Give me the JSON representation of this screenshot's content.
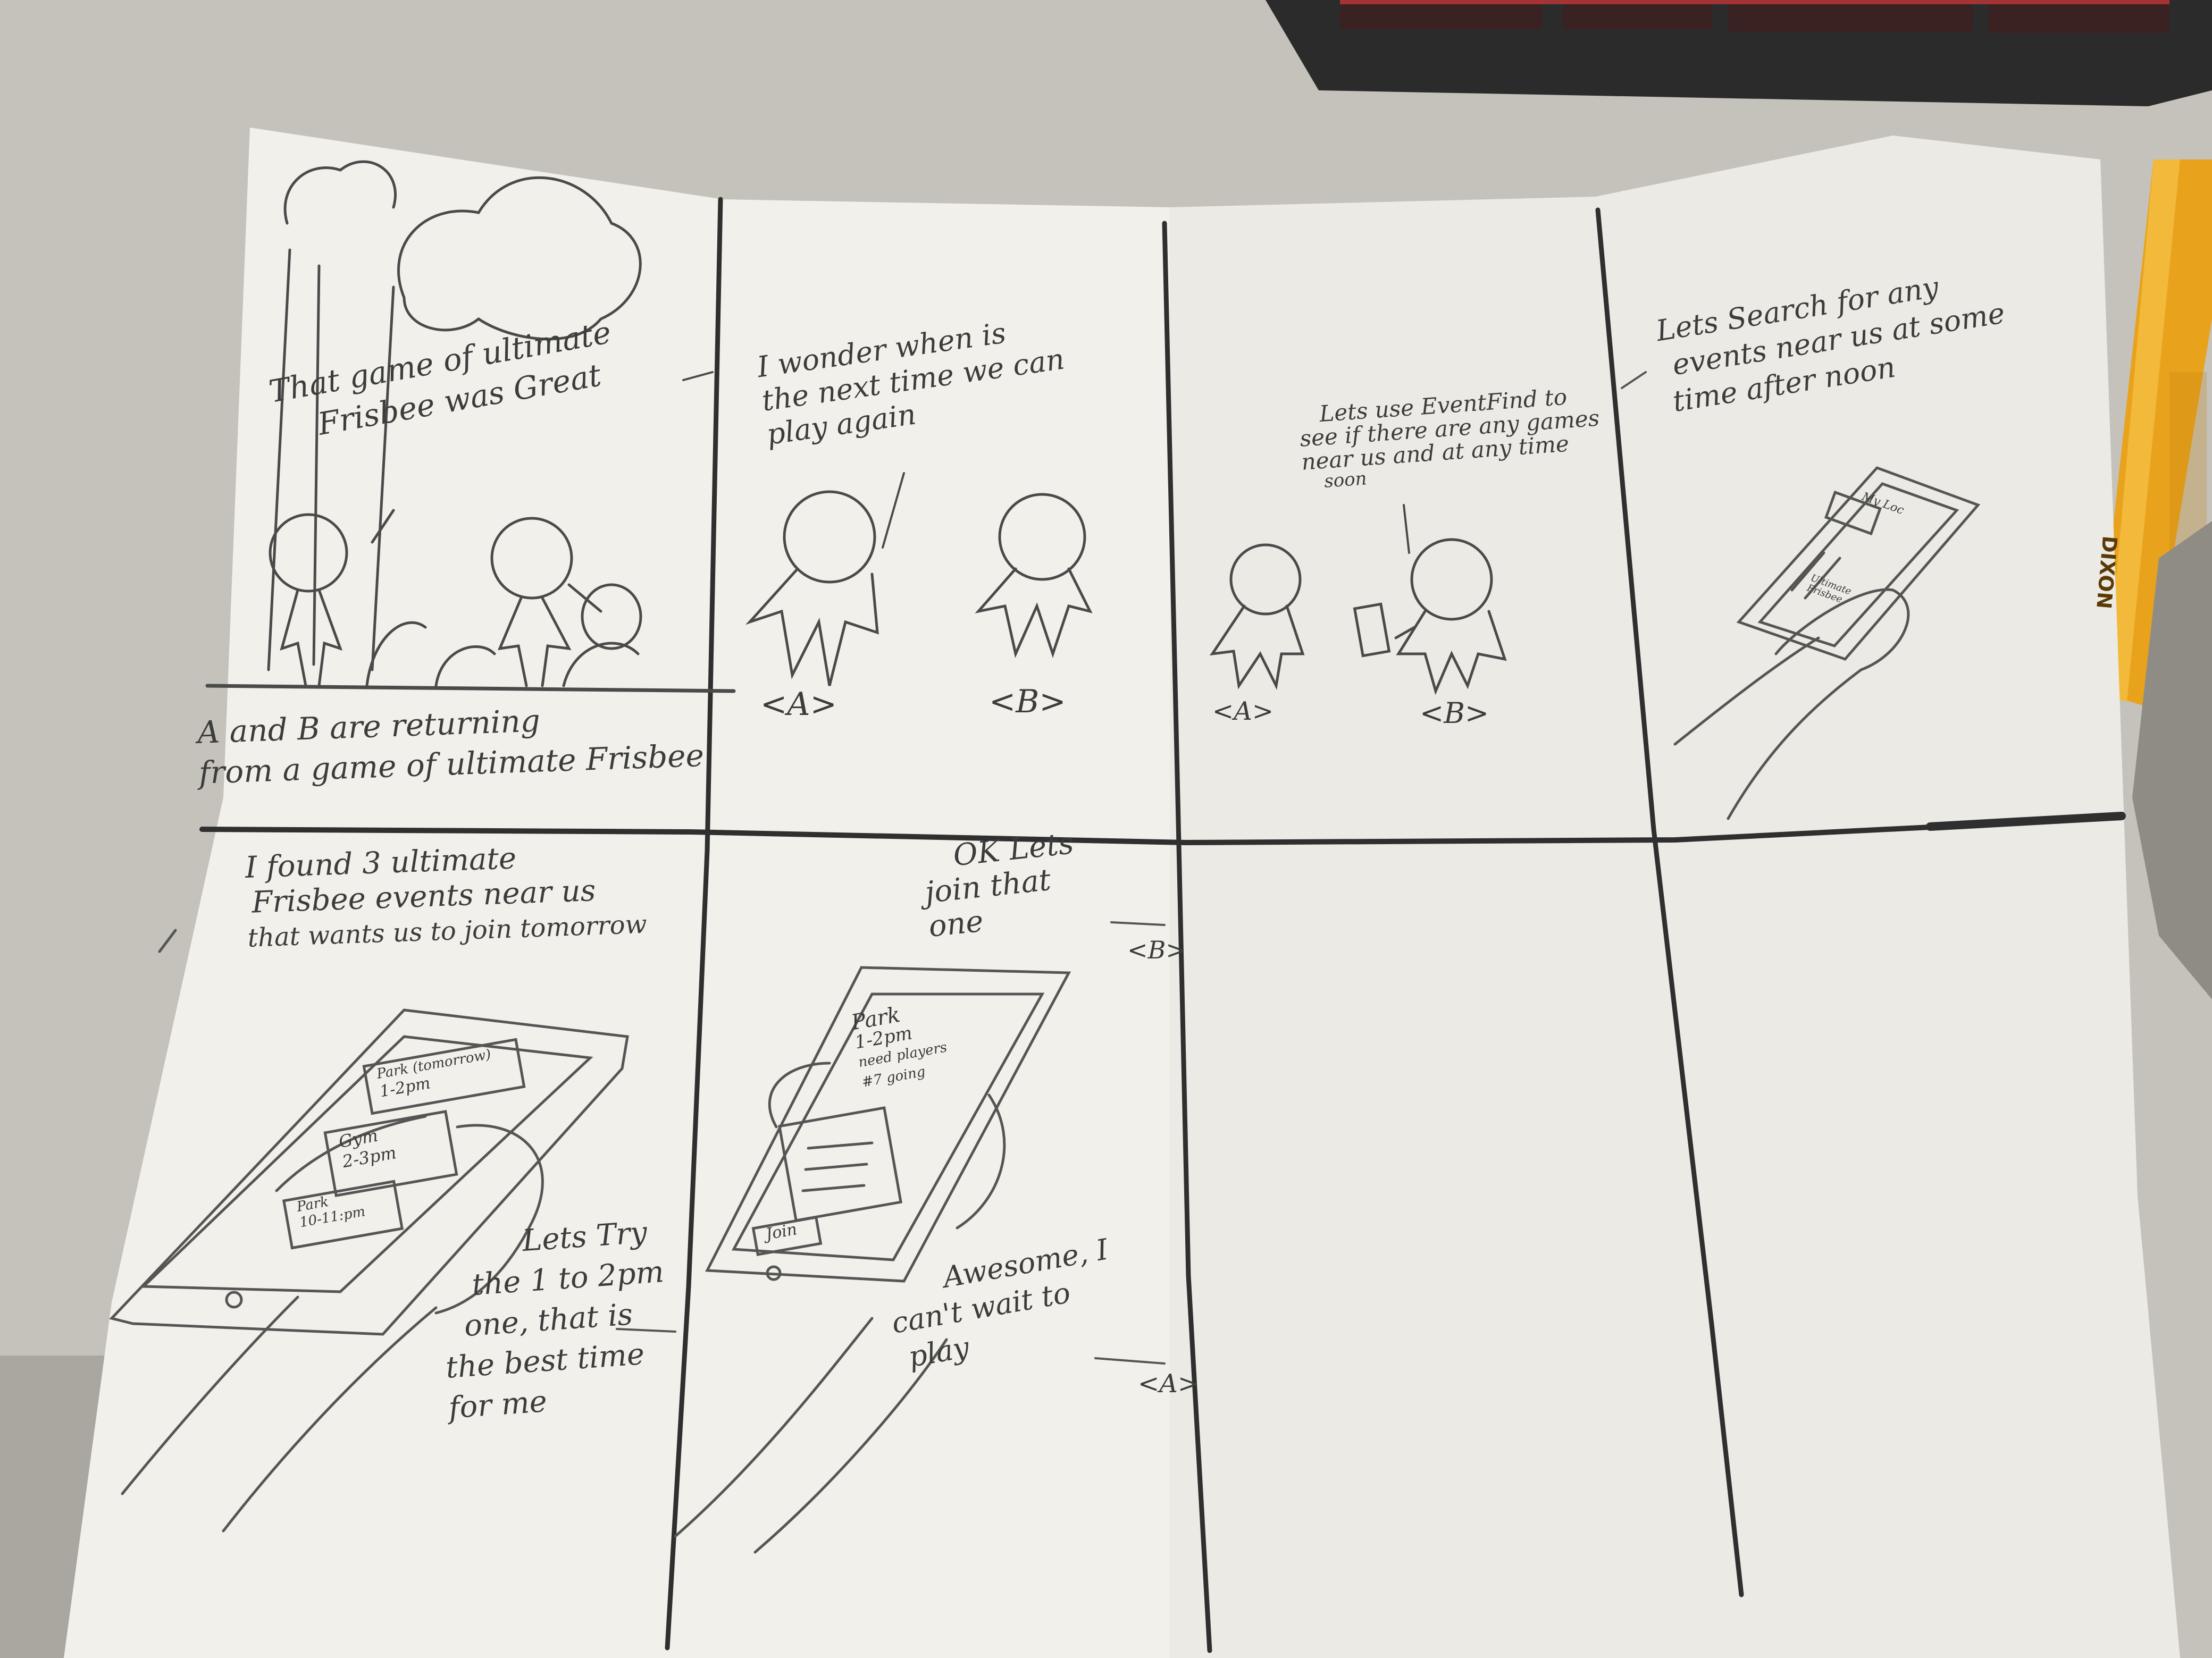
{
  "storyboard": {
    "panels": [
      {
        "id": "panel-1",
        "lines": [
          "That game of ultimate",
          "Frisbee was Great"
        ],
        "narration": [
          "A and B are returning",
          "from a game of ultimate Frisbee"
        ]
      },
      {
        "id": "panel-2",
        "lines": [
          "I wonder when is",
          "the next time we can",
          "play again"
        ],
        "labels": [
          "<A>",
          "<B>"
        ]
      },
      {
        "id": "panel-3",
        "lines": [
          "Lets use EventFind to",
          "see if there are any games",
          "near us and at any time",
          "soon"
        ],
        "labels": [
          "<A>",
          "<B>"
        ]
      },
      {
        "id": "panel-4",
        "lines": [
          "Lets Search for any",
          "events near us at some",
          "time after noon"
        ],
        "phone_text": [
          "My Loc",
          "Ultimate",
          "Frisbee"
        ]
      },
      {
        "id": "panel-5",
        "lines": [
          "I found 3 ultimate",
          "Frisbee events near us",
          "that wants us to join tomorrow"
        ],
        "phone_items": [
          "Park (tomorrow)",
          "1-2pm",
          "Gym",
          "2-3pm",
          "Park",
          "10-11:pm"
        ],
        "reply": [
          "Lets Try",
          "the 1 to 2pm",
          "one, that is",
          "the best time",
          "for me"
        ]
      },
      {
        "id": "panel-6",
        "lines": [
          "OK Lets",
          "join that",
          "one"
        ],
        "speaker": "<B>",
        "phone_details": [
          "Park",
          "1-2pm",
          "need players",
          "#7 going"
        ],
        "join_button": "Join",
        "reply": [
          "Awesome, I",
          "can't wait to",
          "play"
        ],
        "reply_speaker": "<A>"
      },
      {
        "id": "panel-7"
      },
      {
        "id": "panel-8"
      }
    ]
  },
  "surroundings": {
    "pencil_brand": "DIXON"
  }
}
